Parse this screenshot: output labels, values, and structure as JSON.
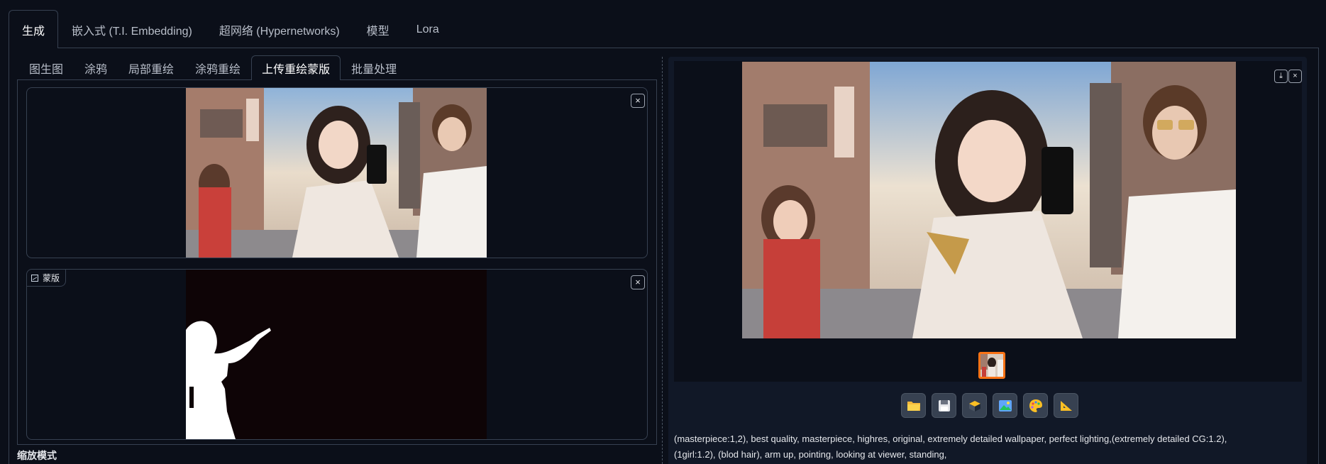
{
  "top_tabs": [
    "生成",
    "嵌入式 (T.I. Embedding)",
    "超网络 (Hypernetworks)",
    "模型",
    "Lora"
  ],
  "sub_tabs": [
    "图生图",
    "涂鸦",
    "局部重绘",
    "涂鸦重绘",
    "上传重绘蒙版",
    "批量处理"
  ],
  "upload_image": {
    "close_label": "×"
  },
  "mask_image": {
    "label": "蒙版",
    "close_label": "×"
  },
  "scale_mode_label": "缩放模式",
  "gallery": {
    "download_label": "⤓",
    "close_label": "×"
  },
  "toolbar": {
    "buttons": [
      {
        "icon": "folder-icon"
      },
      {
        "icon": "save-icon"
      },
      {
        "icon": "archive-icon"
      },
      {
        "icon": "image-icon"
      },
      {
        "icon": "palette-icon"
      },
      {
        "icon": "ruler-icon"
      }
    ]
  },
  "prompt": {
    "line1": "(masterpiece:1,2), best quality, masterpiece, highres, original, extremely detailed wallpaper, perfect lighting,(extremely detailed CG:1.2),",
    "line2": "(1girl:1.2), (blod hair), arm up, pointing, looking at viewer, standing,"
  },
  "colors": {
    "background": "#0b0f19",
    "panel": "#111827",
    "border": "#374151",
    "accent": "#f97316"
  }
}
